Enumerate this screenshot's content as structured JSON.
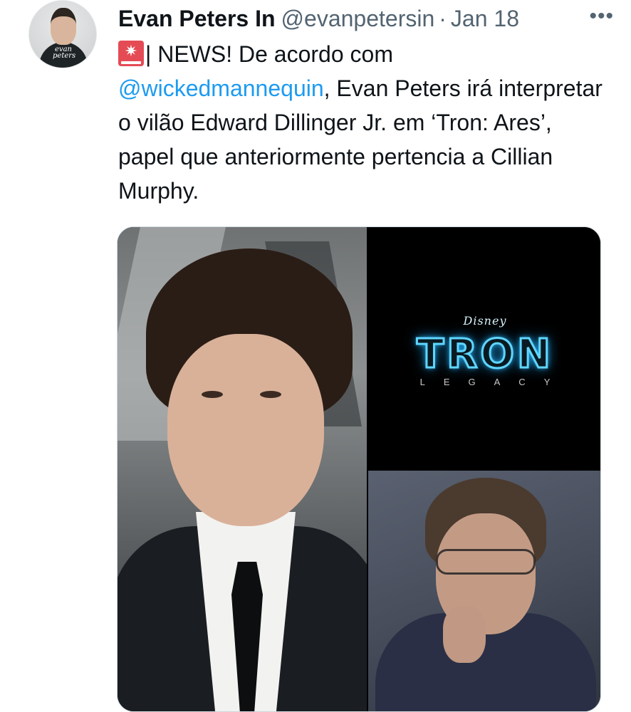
{
  "tweet": {
    "author_name": "Evan Peters In",
    "author_handle": "@evanpetersin",
    "separator": "·",
    "date": "Jan 18",
    "more_label": "•••",
    "avatar_text": "evan peters",
    "text_part1": "| NEWS! De acordo com",
    "mention": "@wickedmannequin",
    "text_part2": ", Evan Peters irá interpretar o vilão Edward Dillinger Jr. em ‘Tron: Ares’, papel que anteriormente pertencia a Cillian Murphy."
  },
  "media": {
    "poster_brand": "Disney",
    "poster_title": "TRON",
    "poster_subtitle": "LEGACY"
  },
  "icons": {
    "siren": "police-car-light-icon",
    "more": "more-horizontal-icon"
  }
}
